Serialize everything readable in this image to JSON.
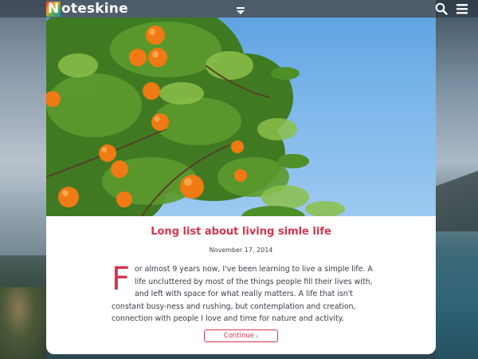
{
  "header": {
    "logo_first": "N",
    "logo_rest": "oteskine",
    "menu_toggle_icon": "chevron-down-icon",
    "search_icon": "search-icon",
    "menu_icon": "hamburger-icon"
  },
  "post": {
    "title": "Long list about living simle life",
    "date": "November 17, 2014",
    "dropcap": "F",
    "body": "or almost 9 years now, I've been learning to live a simple life. A life uncluttered by most of the things people fill their lives with, and left with space for what really matters. A life that isn't constant busy-ness and rushing, but contemplation and creation, connection with people I love and time for nature and activity.",
    "continue_label": "Continue",
    "continue_icon": "chevron-right-icon"
  },
  "colors": {
    "accent": "#d8344f",
    "topbar": "#28303a",
    "card": "#ffffff",
    "text": "#3b3b4a"
  }
}
